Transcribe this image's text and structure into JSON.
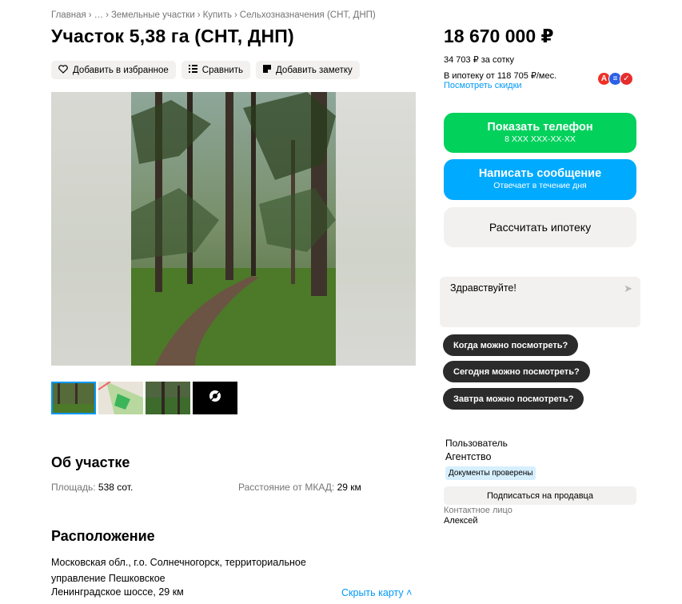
{
  "breadcrumb": [
    "Главная",
    "…",
    "Земельные участки",
    "Купить",
    "Сельхозназначения (СНТ, ДНП)"
  ],
  "breadcrumb_separator": "›",
  "title": "Участок 5,38 га (СНТ, ДНП)",
  "actions": {
    "favorite": "Добавить в избранное",
    "compare": "Сравнить",
    "note": "Добавить заметку"
  },
  "gallery": {
    "photos_count_visible": 4,
    "active_index": 0
  },
  "about": {
    "title": "Об участке",
    "area_label": "Площадь:",
    "area_value": "538 сот.",
    "distance_label": "Расстояние от МКАД:",
    "distance_value": "29 км"
  },
  "location": {
    "title": "Расположение",
    "address": "Московская обл., г.о. Солнечногорск, территориальное управление Пешковское",
    "highway": "Ленинградское шоссе, 29 км",
    "map_link": "Скрыть карту"
  },
  "price": {
    "total": "18 670 000 ₽",
    "per_sotka": "34 703 ₽ за сотку",
    "mortgage": "В ипотеку от 118 705 ₽/мес.",
    "discounts_link": "Посмотреть скидки"
  },
  "banks": [
    {
      "icon": "alfa-bank-icon",
      "glyph": "А",
      "color": "#ef3124"
    },
    {
      "icon": "bank-lines-icon",
      "glyph": "≡",
      "color": "#2b61e4"
    },
    {
      "icon": "bank-check-icon",
      "glyph": "✓",
      "color": "#e62d2d"
    }
  ],
  "buttons": {
    "phone": "Показать телефон",
    "phone_sub": "8 XXX XXX-XX-XX",
    "message": "Написать сообщение",
    "message_sub": "Отвечает в течение дня",
    "mortgage": "Рассчитать ипотеку"
  },
  "chat": {
    "text": "Здравствуйте!"
  },
  "quick_questions": [
    "Когда можно посмотреть?",
    "Сегодня можно посмотреть?",
    "Завтра можно посмотреть?"
  ],
  "seller": {
    "type": "Пользователь",
    "name": "Агентство",
    "badge": "Документы проверены",
    "subscribe": "Подписаться на продавца",
    "contact_label": "Контактное лицо",
    "contact_name": "Алексей"
  },
  "colors": {
    "green": "#02d15c",
    "blue": "#00aaff",
    "link": "#0099f7",
    "gray_bg": "#f2f1f0",
    "dark_chip": "#2b2b2b"
  }
}
